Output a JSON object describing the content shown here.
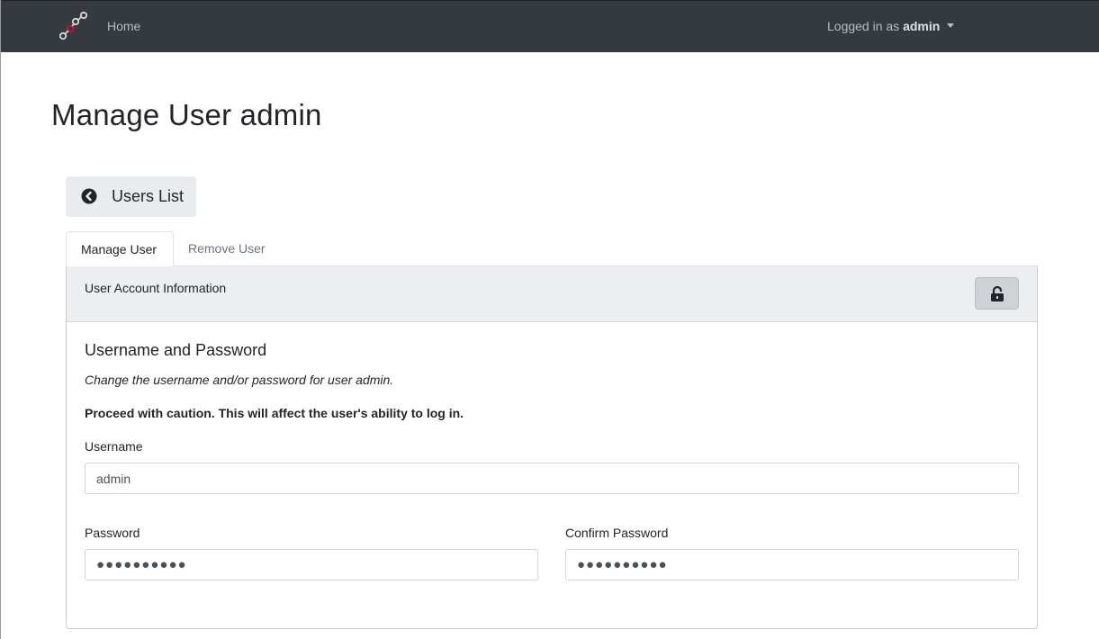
{
  "navbar": {
    "home_label": "Home",
    "logged_in_prefix": "Logged in as",
    "username": "admin",
    "logo_icon": "graph-nodes-logo"
  },
  "page": {
    "title": "Manage User admin"
  },
  "back_button": {
    "label": "Users List",
    "icon": "chevron-circle-left-icon"
  },
  "tabs": [
    {
      "label": "Manage User",
      "active": true
    },
    {
      "label": "Remove User",
      "active": false
    }
  ],
  "card": {
    "header_title": "User Account Information",
    "lock_icon": "unlock-icon",
    "section_title": "Username and Password",
    "description": "Change the username and/or password for user admin.",
    "warning": "Proceed with caution. This will affect the user's ability to log in."
  },
  "form": {
    "username_label": "Username",
    "username_value": "admin",
    "password_label": "Password",
    "password_value": "●●●●●●●●●●",
    "confirm_label": "Confirm Password",
    "confirm_value": "●●●●●●●●●●"
  },
  "colors": {
    "navbar_bg": "#343a40",
    "card_header_bg": "#eceef1",
    "logo_accent": "#c8102e"
  }
}
